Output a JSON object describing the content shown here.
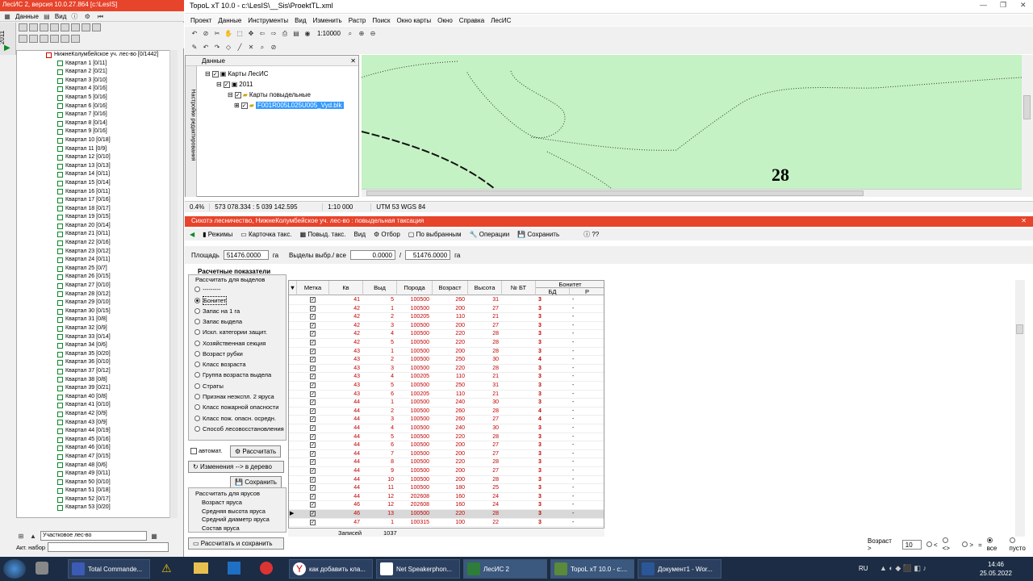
{
  "left_window": {
    "title": "ЛесИС 2, версия 10.0.27.864  [c:\\LesIS]",
    "menu": [
      "Данные",
      "Вид"
    ],
    "vtab": "2011",
    "tree_root": "НижнеКолумбейское уч. лес-во [0/1442]",
    "tree_items": [
      "Квартал 1 [0/11]",
      "Квартал 2 [0/21]",
      "Квартал 3 [0/10]",
      "Квартал 4 [0/16]",
      "Квартал 5 [0/16]",
      "Квартал 6 [0/16]",
      "Квартал 7 [0/16]",
      "Квартал 8 [0/14]",
      "Квартал 9 [0/16]",
      "Квартал 10 [0/18]",
      "Квартал 11 [0/9]",
      "Квартал 12 [0/10]",
      "Квартал 13 [0/13]",
      "Квартал 14 [0/11]",
      "Квартал 15 [0/14]",
      "Квартал 16 [0/11]",
      "Квартал 17 [0/16]",
      "Квартал 18 [0/17]",
      "Квартал 19 [0/15]",
      "Квартал 20 [0/14]",
      "Квартал 21 [0/11]",
      "Квартал 22 [0/16]",
      "Квартал 23 [0/12]",
      "Квартал 24 [0/11]",
      "Квартал 25 [0/7]",
      "Квартал 26 [0/15]",
      "Квартал 27 [0/10]",
      "Квартал 28 [0/12]",
      "Квартал 29 [0/10]",
      "Квартал 30 [0/15]",
      "Квартал 31 [0/8]",
      "Квартал 32 [0/9]",
      "Квартал 33 [0/14]",
      "Квартал 34 [0/6]",
      "Квартал 35 [0/20]",
      "Квартал 36 [0/10]",
      "Квартал 37 [0/12]",
      "Квартал 38 [0/8]",
      "Квартал 39 [0/21]",
      "Квартал 40 [0/8]",
      "Квартал 41 [0/10]",
      "Квартал 42 [0/9]",
      "Квартал 43 [0/9]",
      "Квартал 44 [0/19]",
      "Квартал 45 [0/16]",
      "Квартал 46 [0/16]",
      "Квартал 47 [0/15]",
      "Квартал 48 [0/6]",
      "Квартал 49 [0/11]",
      "Квартал 50 [0/10]",
      "Квартал 51 [0/18]",
      "Квартал 52 [0/17]",
      "Квартал 53 [0/20]"
    ],
    "combo_value": "Участковое лес-во",
    "akt_label": "Акт. набор"
  },
  "topol": {
    "title": "TopoL xT 10.0 - c:\\LesIS\\__Sis\\ProektTL.xml",
    "menu": [
      "Проект",
      "Данные",
      "Инструменты",
      "Вид",
      "Изменить",
      "Растр",
      "Поиск",
      "Окно карты",
      "Окно",
      "Справка",
      "ЛесИС"
    ],
    "scale": "1:10000",
    "data_panel_title": "Данные",
    "side_tab": "Настройки редактирования",
    "layers": [
      "Карты ЛесИС",
      "2011",
      "Карты повыдельные",
      "F001R005L025U005_Vyd.blk"
    ],
    "map_label": "28",
    "status": [
      "0.4%",
      "573 078.334 : 5 039 142.595",
      "1:10 000",
      "UTM 53 WGS 84"
    ]
  },
  "bottom_window": {
    "title": "Сихотэ лесничество, НижнеКолумбейское уч. лес-во : повыдельная таксация",
    "toolbar": [
      "Режимы",
      "Карточка такс.",
      "Повыд. такс.",
      "Вид",
      "Отбор",
      "По выбранным",
      "Операции",
      "Сохранить",
      "??"
    ],
    "area_label": "Площадь",
    "area_value": "51476.0000",
    "unit": "га",
    "selected_label": "Выделы выбр./ все",
    "selected_value": "0.0000",
    "slash": "/",
    "all_value": "51476.0000",
    "calc_title": "Расчетные показатели",
    "calc_for": "Рассчитать для выделов",
    "radios": [
      "---------",
      "Бонитет",
      "Запас на 1 га",
      "Запас выдела",
      "Искл. категории защит.",
      "Хозяйственная секция",
      "Возраст рубки",
      "Класс возраста",
      "Группа возраста выдела",
      "Страты",
      "Признак неэкспл. 2 яруса",
      "Класс пожарной опасности",
      "Класс пож. опасн. осредн.",
      "Способ лесовосстановления"
    ],
    "selected_radio": 1,
    "auto_label": "автомат.",
    "btn_calc": "Рассчитать",
    "btn_changes": "Изменения --> в дерево",
    "btn_save": "Сохранить",
    "yarus_title": "Рассчитать для ярусов",
    "yarus_items": [
      "Возраст яруса",
      "Средняя высота яруса",
      "Средний диаметр яруса",
      "Состав яруса"
    ],
    "btn_calc_save": "Рассчитать и сохранить",
    "columns": [
      "Метка",
      "Кв",
      "Выд",
      "Порода",
      "Возраст",
      "Высота",
      "№ БТ",
      "Бонитет",
      "БД",
      "Р"
    ],
    "rows": [
      [
        "41",
        "5",
        "100500",
        "260",
        "31",
        "3",
        "-"
      ],
      [
        "42",
        "1",
        "100500",
        "200",
        "27",
        "3",
        "-"
      ],
      [
        "42",
        "2",
        "100205",
        "110",
        "21",
        "3",
        "-"
      ],
      [
        "42",
        "3",
        "100500",
        "200",
        "27",
        "3",
        "-"
      ],
      [
        "42",
        "4",
        "100500",
        "220",
        "28",
        "3",
        "-"
      ],
      [
        "42",
        "5",
        "100500",
        "220",
        "28",
        "3",
        "-"
      ],
      [
        "43",
        "1",
        "100500",
        "200",
        "28",
        "3",
        "-"
      ],
      [
        "43",
        "2",
        "100500",
        "250",
        "30",
        "4",
        "-"
      ],
      [
        "43",
        "3",
        "100500",
        "220",
        "28",
        "3",
        "-"
      ],
      [
        "43",
        "4",
        "100205",
        "110",
        "21",
        "3",
        "-"
      ],
      [
        "43",
        "5",
        "100500",
        "250",
        "31",
        "3",
        "-"
      ],
      [
        "43",
        "6",
        "100205",
        "110",
        "21",
        "3",
        "-"
      ],
      [
        "44",
        "1",
        "100500",
        "240",
        "30",
        "3",
        "-"
      ],
      [
        "44",
        "2",
        "100500",
        "260",
        "28",
        "4",
        "-"
      ],
      [
        "44",
        "3",
        "100500",
        "260",
        "27",
        "4",
        "-"
      ],
      [
        "44",
        "4",
        "100500",
        "240",
        "30",
        "3",
        "-"
      ],
      [
        "44",
        "5",
        "100500",
        "220",
        "28",
        "3",
        "-"
      ],
      [
        "44",
        "6",
        "100500",
        "200",
        "27",
        "3",
        "-"
      ],
      [
        "44",
        "7",
        "100500",
        "200",
        "27",
        "3",
        "-"
      ],
      [
        "44",
        "8",
        "100500",
        "220",
        "28",
        "3",
        "-"
      ],
      [
        "44",
        "9",
        "100500",
        "200",
        "27",
        "3",
        "-"
      ],
      [
        "44",
        "10",
        "100500",
        "200",
        "28",
        "3",
        "-"
      ],
      [
        "44",
        "11",
        "100500",
        "180",
        "25",
        "3",
        "-"
      ],
      [
        "44",
        "12",
        "202608",
        "160",
        "24",
        "3",
        "-"
      ],
      [
        "46",
        "12",
        "202608",
        "160",
        "24",
        "3",
        "-"
      ],
      [
        "46",
        "13",
        "100500",
        "220",
        "28",
        "3",
        "-"
      ],
      [
        "47",
        "1",
        "100315",
        "100",
        "22",
        "3",
        "-"
      ]
    ],
    "records_label": "Записей",
    "records_count": "1037",
    "age_label": "Возраст >",
    "age_value": "10",
    "filter_opts": [
      "<",
      "<>",
      ">",
      "=",
      "все",
      "пусто"
    ]
  },
  "taskbar": {
    "items": [
      "Total Commande...",
      "как добавить кла...",
      "Net Speakerphon...",
      "ЛесИС 2",
      "TopoL xT 10.0 - c:...",
      "Документ1 - Wor..."
    ],
    "lang": "RU",
    "time": "14:46",
    "date": "25.05.2022"
  },
  "colors": {
    "title_red": "#e7442c",
    "map_green": "#c4f2c4",
    "value_red": "#c00000",
    "taskbar": "#1b2c44"
  }
}
